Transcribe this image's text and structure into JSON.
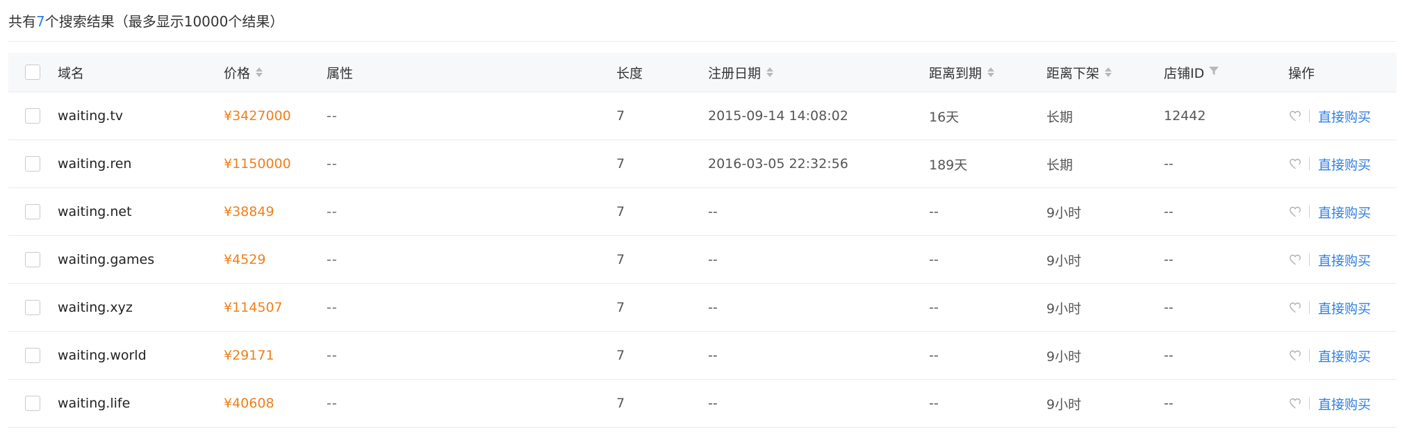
{
  "summary": {
    "prefix": "共有",
    "count": "7",
    "suffix": "个搜索结果（最多显示10000个结果）"
  },
  "colors": {
    "price": "#f07f1a",
    "link": "#2f7fe0",
    "header_bg": "#f7f8fa",
    "border": "#ebebeb"
  },
  "table": {
    "headers": {
      "name": "域名",
      "price": "价格",
      "attr": "属性",
      "length": "长度",
      "reg_date": "注册日期",
      "expire": "距离到期",
      "offshelf": "距离下架",
      "shop_id": "店铺ID",
      "action": "操作"
    },
    "header_icons": {
      "price": "sort-icon",
      "reg_date": "sort-icon",
      "expire": "sort-icon",
      "offshelf": "sort-icon",
      "shop_id": "filter-icon"
    },
    "rows": [
      {
        "name": "waiting.tv",
        "price": "¥3427000",
        "attr": "--",
        "length": "7",
        "reg_date": "2015-09-14 14:08:02",
        "expire": "16天",
        "offshelf": "长期",
        "shop_id": "12442",
        "action": "直接购买"
      },
      {
        "name": "waiting.ren",
        "price": "¥1150000",
        "attr": "--",
        "length": "7",
        "reg_date": "2016-03-05 22:32:56",
        "expire": "189天",
        "offshelf": "长期",
        "shop_id": "--",
        "action": "直接购买"
      },
      {
        "name": "waiting.net",
        "price": "¥38849",
        "attr": "--",
        "length": "7",
        "reg_date": "--",
        "expire": "--",
        "offshelf": "9小时",
        "shop_id": "--",
        "action": "直接购买"
      },
      {
        "name": "waiting.games",
        "price": "¥4529",
        "attr": "--",
        "length": "7",
        "reg_date": "--",
        "expire": "--",
        "offshelf": "9小时",
        "shop_id": "--",
        "action": "直接购买"
      },
      {
        "name": "waiting.xyz",
        "price": "¥114507",
        "attr": "--",
        "length": "7",
        "reg_date": "--",
        "expire": "--",
        "offshelf": "9小时",
        "shop_id": "--",
        "action": "直接购买"
      },
      {
        "name": "waiting.world",
        "price": "¥29171",
        "attr": "--",
        "length": "7",
        "reg_date": "--",
        "expire": "--",
        "offshelf": "9小时",
        "shop_id": "--",
        "action": "直接购买"
      },
      {
        "name": "waiting.life",
        "price": "¥40608",
        "attr": "--",
        "length": "7",
        "reg_date": "--",
        "expire": "--",
        "offshelf": "9小时",
        "shop_id": "--",
        "action": "直接购买"
      }
    ]
  }
}
